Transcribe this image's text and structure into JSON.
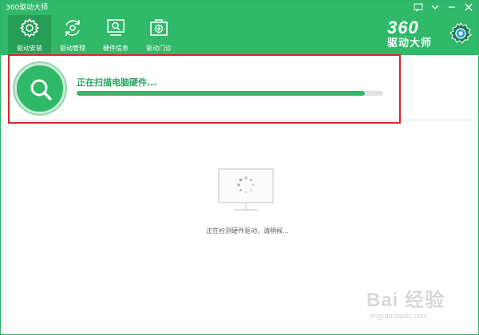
{
  "window": {
    "title": "360驱动大师",
    "controls": [
      "menu-icon",
      "minimize-icon",
      "close-icon"
    ]
  },
  "nav": {
    "items": [
      {
        "label": "驱动安装",
        "icon": "gear-icon",
        "active": true
      },
      {
        "label": "驱动管理",
        "icon": "refresh-icon",
        "active": false
      },
      {
        "label": "硬件信息",
        "icon": "monitor-search-icon",
        "active": false
      },
      {
        "label": "驱动门诊",
        "icon": "medical-kit-icon",
        "active": false
      }
    ]
  },
  "brand": {
    "number": "360",
    "text": "驱动大师"
  },
  "scan": {
    "status_text": "正在扫描电脑硬件...",
    "progress": 0.94
  },
  "detect": {
    "text": "正在检测硬件驱动，请稍候..."
  },
  "watermark": {
    "brand": "Bai 经验",
    "site": "jingyan.baidu.com"
  },
  "colors": {
    "header": "#2fb968",
    "active_tab": "#279e58",
    "progress": "#2fb968",
    "highlight_border": "#d9252a",
    "status_text": "#2aa55f"
  }
}
